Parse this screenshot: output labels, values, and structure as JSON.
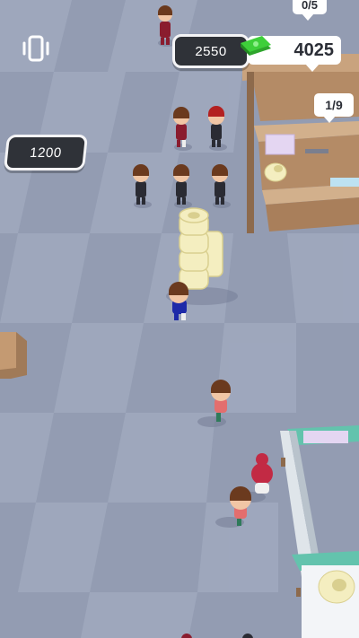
{
  "hud": {
    "vibration_icon": "phone-vibrate-icon",
    "money_icon": "cash-stack-icon",
    "money_value": "4025",
    "money_color": "#3ecf3a"
  },
  "zones": {
    "unlock_cost_left": "1200",
    "unlock_cost_top": "2550",
    "top_bubble": "0/5",
    "stall_capacity": "1/9"
  },
  "colors": {
    "floor_light": "#9aa3b8",
    "floor_dark": "#8a93aa",
    "wood": "#b48b66",
    "teal_stall": "#63c3ad",
    "paper_roll": "#f4eec0"
  }
}
